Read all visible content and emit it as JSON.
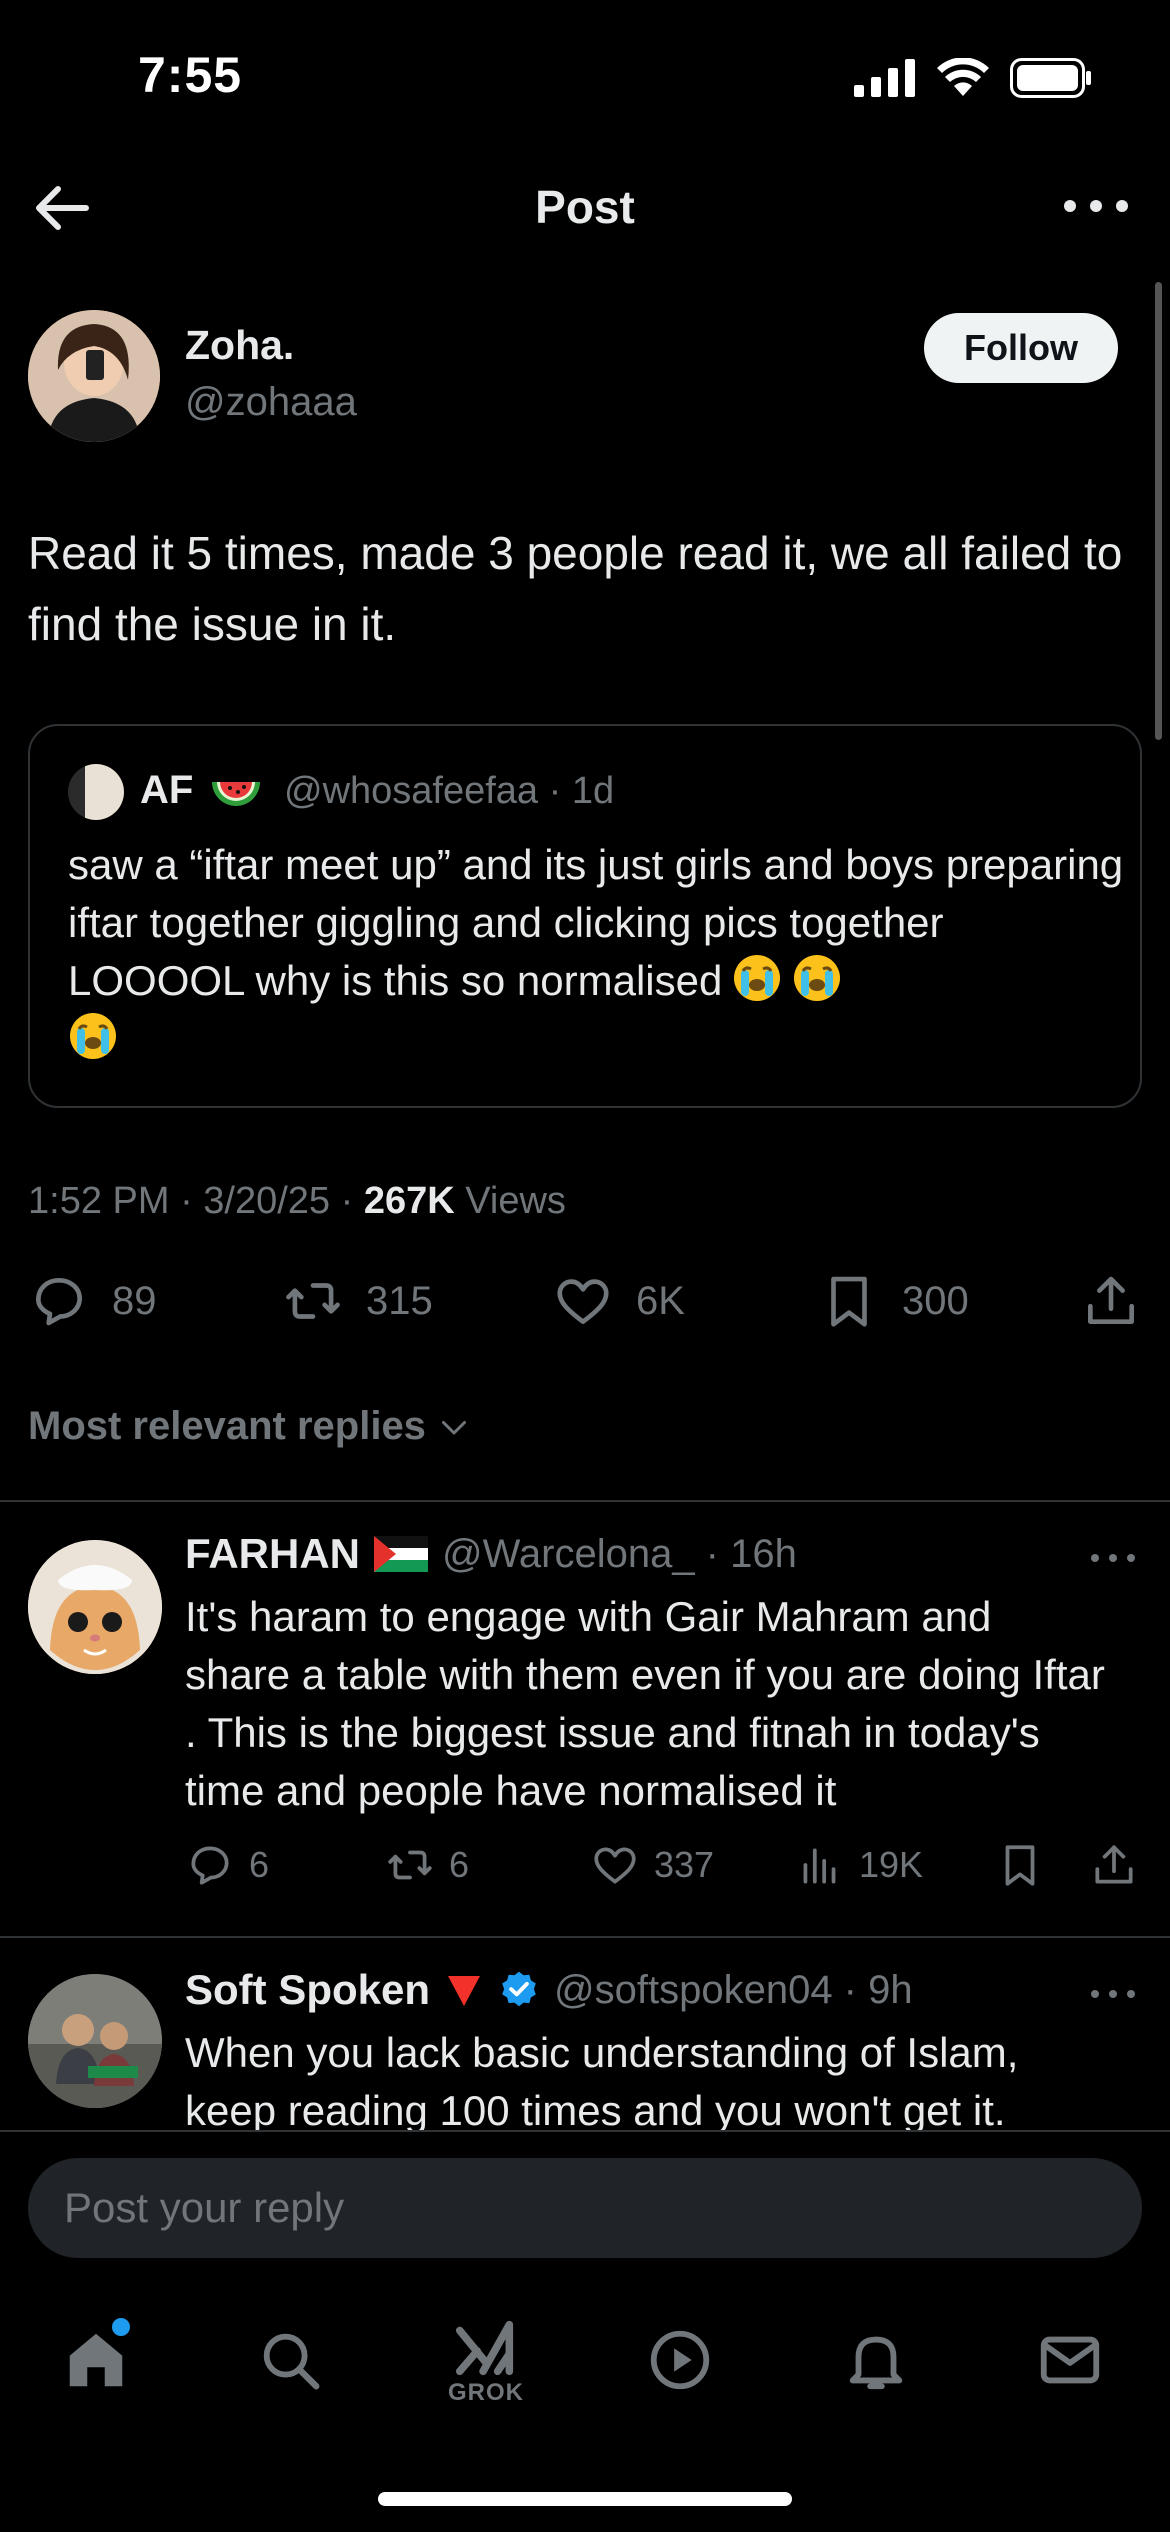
{
  "status_bar": {
    "time": "7:55"
  },
  "nav": {
    "title": "Post"
  },
  "post": {
    "author_name": "Zoha.",
    "author_handle": "@zohaaa",
    "follow_label": "Follow",
    "text": "Read it 5 times, made 3 people read it, we all failed to find the issue in it.",
    "quoted": {
      "name": "AF",
      "handle_time": "@whosafeefaa · 1d",
      "text": "saw a “iftar meet up” and its just girls and boys preparing iftar together giggling and clicking pics together LOOOOL why is this so normalised"
    },
    "time_date": "1:52 PM · 3/20/25 · ",
    "views_count": "267K",
    "views_label": " Views",
    "stats": {
      "replies": "89",
      "reposts": "315",
      "likes": "6K",
      "bookmarks": "300"
    }
  },
  "replies_header": "Most relevant replies",
  "replies": [
    {
      "name": "FARHAN",
      "handle_time": "@Warcelona_ · 16h",
      "text": "It's haram to engage with Gair Mahram and share a table with them even if you are doing Iftar . This is the biggest issue and fitnah in today's time and people have normalised it",
      "replies": "6",
      "reposts": "6",
      "likes": "337",
      "views": "19K"
    },
    {
      "name": "Soft Spoken",
      "handle_time": "@softspoken04 · 9h",
      "text": "When you lack basic understanding of Islam, keep reading 100 times and you won't get it."
    }
  ],
  "reply_bar": {
    "placeholder": "Post your reply"
  },
  "tabs": {
    "grok_label": "GROK"
  },
  "colors": {
    "accent": "#1d9bf0",
    "muted": "#71767b",
    "text": "#e7e9ea",
    "background": "#000000"
  }
}
